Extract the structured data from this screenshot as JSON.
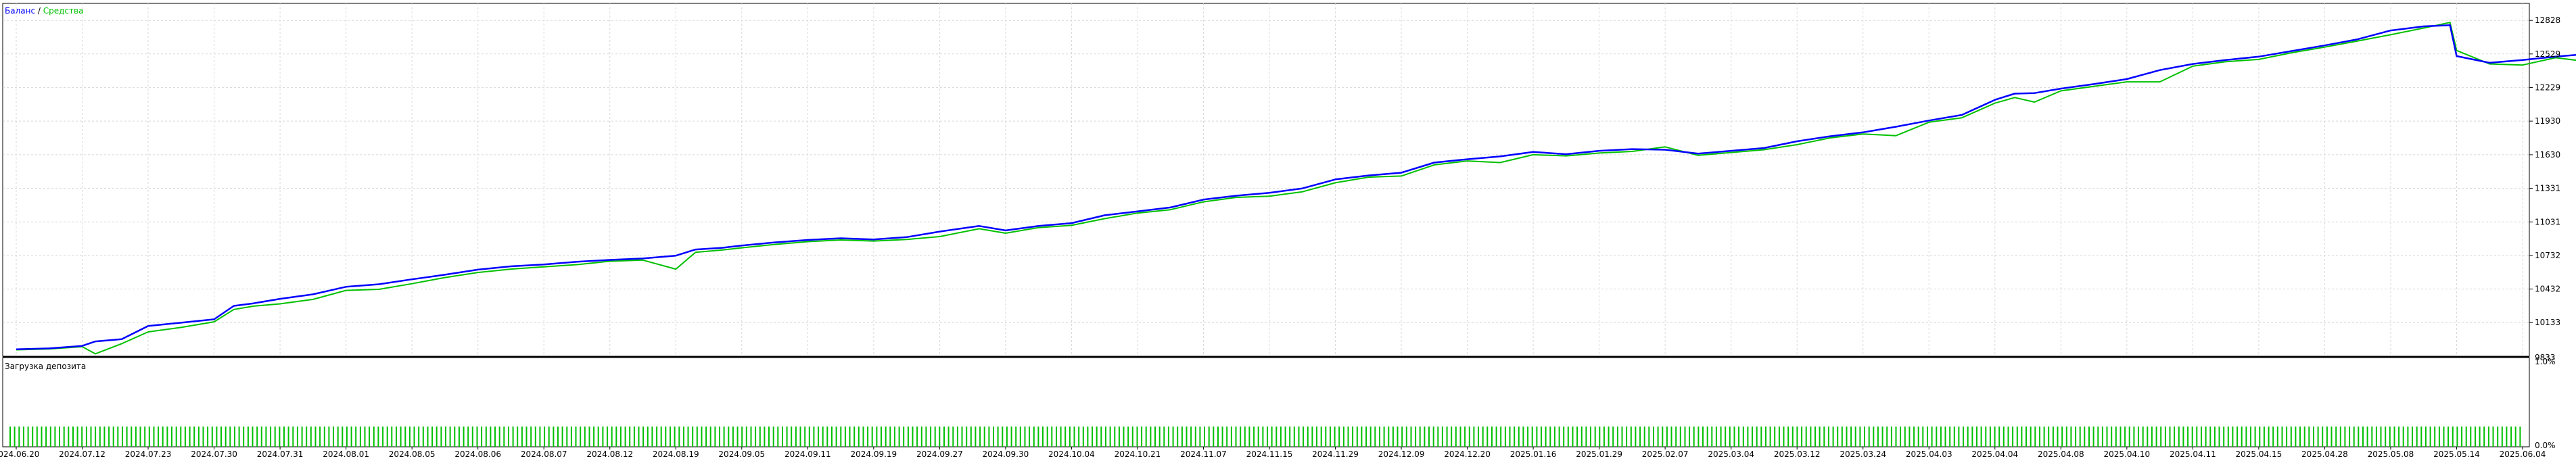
{
  "chart_data": [
    {
      "type": "line",
      "legend": [
        {
          "name": "Баланс",
          "color": "#0000ff"
        },
        {
          "name": "Средства",
          "color": "#00c000"
        }
      ],
      "legend_separator": " / ",
      "legend_placement": "top-left",
      "grid": true,
      "ylim": [
        9833,
        12980
      ],
      "y_ticks": [
        10133,
        10432,
        10732,
        11031,
        11331,
        11630,
        11930,
        12229,
        12529,
        12828
      ],
      "y_cut_label": "9833",
      "x_tick_labels": [
        "2024.06.20",
        "2024.07.12",
        "2024.07.23",
        "2024.07.30",
        "2024.07.31",
        "2024.08.01",
        "2024.08.05",
        "2024.08.06",
        "2024.08.07",
        "2024.08.12",
        "2024.08.19",
        "2024.09.05",
        "2024.09.11",
        "2024.09.19",
        "2024.09.27",
        "2024.09.30",
        "2024.10.04",
        "2024.10.21",
        "2024.11.07",
        "2024.11.15",
        "2024.11.29",
        "2024.12.09",
        "2024.12.20",
        "2025.01.16",
        "2025.01.29",
        "2025.02.07",
        "2025.03.04",
        "2025.03.12",
        "2025.03.24",
        "2025.04.03",
        "2025.04.04",
        "2025.04.08",
        "2025.04.10",
        "2025.04.11",
        "2025.04.15",
        "2025.04.28",
        "2025.05.08",
        "2025.05.14",
        "2025.06.04"
      ],
      "series": [
        {
          "name": "Баланс",
          "points": [
            [
              0,
              9895
            ],
            [
              0.5,
              9903
            ],
            [
              1,
              9925
            ],
            [
              1.2,
              9965
            ],
            [
              1.6,
              9985
            ],
            [
              2,
              10103
            ],
            [
              2.5,
              10132
            ],
            [
              3,
              10162
            ],
            [
              3.3,
              10282
            ],
            [
              3.6,
              10305
            ],
            [
              4,
              10345
            ],
            [
              4.5,
              10385
            ],
            [
              5,
              10452
            ],
            [
              5.5,
              10475
            ],
            [
              6,
              10519
            ],
            [
              6.5,
              10560
            ],
            [
              7,
              10605
            ],
            [
              7.5,
              10635
            ],
            [
              8,
              10652
            ],
            [
              8.5,
              10675
            ],
            [
              9,
              10692
            ],
            [
              9.5,
              10705
            ],
            [
              10,
              10730
            ],
            [
              10.3,
              10785
            ],
            [
              10.7,
              10800
            ],
            [
              11,
              10820
            ],
            [
              11.5,
              10848
            ],
            [
              12,
              10870
            ],
            [
              12.5,
              10885
            ],
            [
              13,
              10875
            ],
            [
              13.5,
              10895
            ],
            [
              14,
              10945
            ],
            [
              14.6,
              10995
            ],
            [
              15,
              10955
            ],
            [
              15.5,
              10995
            ],
            [
              16,
              11020
            ],
            [
              16.5,
              11090
            ],
            [
              17,
              11125
            ],
            [
              17.5,
              11160
            ],
            [
              18,
              11230
            ],
            [
              18.5,
              11265
            ],
            [
              19,
              11290
            ],
            [
              19.5,
              11330
            ],
            [
              20,
              11410
            ],
            [
              20.5,
              11445
            ],
            [
              21,
              11470
            ],
            [
              21.5,
              11560
            ],
            [
              22,
              11590
            ],
            [
              22.5,
              11615
            ],
            [
              23,
              11655
            ],
            [
              23.5,
              11635
            ],
            [
              24,
              11665
            ],
            [
              24.5,
              11680
            ],
            [
              25,
              11675
            ],
            [
              25.5,
              11640
            ],
            [
              26,
              11665
            ],
            [
              26.5,
              11690
            ],
            [
              27,
              11750
            ],
            [
              27.5,
              11795
            ],
            [
              28,
              11830
            ],
            [
              28.5,
              11880
            ],
            [
              29,
              11935
            ],
            [
              29.5,
              11985
            ],
            [
              30,
              12120
            ],
            [
              30.3,
              12175
            ],
            [
              30.6,
              12180
            ],
            [
              31,
              12220
            ],
            [
              31.5,
              12260
            ],
            [
              32,
              12305
            ],
            [
              32.5,
              12385
            ],
            [
              33,
              12440
            ],
            [
              33.5,
              12475
            ],
            [
              34,
              12505
            ],
            [
              34.5,
              12555
            ],
            [
              35,
              12605
            ],
            [
              35.5,
              12660
            ],
            [
              36,
              12738
            ],
            [
              36.5,
              12775
            ],
            [
              36.9,
              12785
            ],
            [
              37,
              12510
            ],
            [
              37.5,
              12450
            ],
            [
              38,
              12475
            ],
            [
              38.5,
              12505
            ],
            [
              39,
              12530
            ]
          ]
        },
        {
          "name": "Средства",
          "points": [
            [
              0,
              9890
            ],
            [
              0.5,
              9898
            ],
            [
              1,
              9918
            ],
            [
              1.2,
              9855
            ],
            [
              1.6,
              9945
            ],
            [
              2,
              10050
            ],
            [
              2.5,
              10090
            ],
            [
              3,
              10140
            ],
            [
              3.3,
              10250
            ],
            [
              3.6,
              10280
            ],
            [
              4,
              10300
            ],
            [
              4.5,
              10340
            ],
            [
              5,
              10420
            ],
            [
              5.5,
              10430
            ],
            [
              6,
              10480
            ],
            [
              6.5,
              10535
            ],
            [
              7,
              10580
            ],
            [
              7.5,
              10610
            ],
            [
              8,
              10630
            ],
            [
              8.5,
              10650
            ],
            [
              9,
              10680
            ],
            [
              9.5,
              10690
            ],
            [
              10,
              10610
            ],
            [
              10.3,
              10760
            ],
            [
              10.7,
              10780
            ],
            [
              11,
              10800
            ],
            [
              11.5,
              10830
            ],
            [
              12,
              10855
            ],
            [
              12.5,
              10870
            ],
            [
              13,
              10860
            ],
            [
              13.5,
              10875
            ],
            [
              14,
              10900
            ],
            [
              14.6,
              10970
            ],
            [
              15,
              10930
            ],
            [
              15.5,
              10980
            ],
            [
              16,
              11000
            ],
            [
              16.5,
              11060
            ],
            [
              17,
              11110
            ],
            [
              17.5,
              11140
            ],
            [
              18,
              11210
            ],
            [
              18.5,
              11250
            ],
            [
              19,
              11260
            ],
            [
              19.5,
              11300
            ],
            [
              20,
              11380
            ],
            [
              20.5,
              11430
            ],
            [
              21,
              11440
            ],
            [
              21.5,
              11540
            ],
            [
              22,
              11575
            ],
            [
              22.5,
              11560
            ],
            [
              23,
              11630
            ],
            [
              23.5,
              11620
            ],
            [
              24,
              11645
            ],
            [
              24.5,
              11660
            ],
            [
              25,
              11700
            ],
            [
              25.5,
              11625
            ],
            [
              26,
              11650
            ],
            [
              26.5,
              11675
            ],
            [
              27,
              11720
            ],
            [
              27.5,
              11780
            ],
            [
              28,
              11815
            ],
            [
              28.5,
              11800
            ],
            [
              29,
              11920
            ],
            [
              29.5,
              11960
            ],
            [
              30,
              12090
            ],
            [
              30.3,
              12140
            ],
            [
              30.6,
              12100
            ],
            [
              31,
              12200
            ],
            [
              31.5,
              12240
            ],
            [
              32,
              12280
            ],
            [
              32.5,
              12280
            ],
            [
              33,
              12420
            ],
            [
              33.5,
              12460
            ],
            [
              34,
              12480
            ],
            [
              34.5,
              12540
            ],
            [
              35,
              12590
            ],
            [
              35.5,
              12645
            ],
            [
              36,
              12700
            ],
            [
              36.5,
              12760
            ],
            [
              36.9,
              12810
            ],
            [
              37,
              12560
            ],
            [
              37.5,
              12440
            ],
            [
              38,
              12430
            ],
            [
              38.5,
              12495
            ],
            [
              39,
              12460
            ]
          ]
        }
      ]
    },
    {
      "type": "bar",
      "title": "Загрузка депозита",
      "title_placement": "top-left",
      "y_ticks": [
        "1.0%",
        "0.0%"
      ],
      "ylim": [
        0,
        1.0
      ],
      "bar_color": "#00c000",
      "bar_count": 560,
      "bar_value": 0.25
    }
  ]
}
